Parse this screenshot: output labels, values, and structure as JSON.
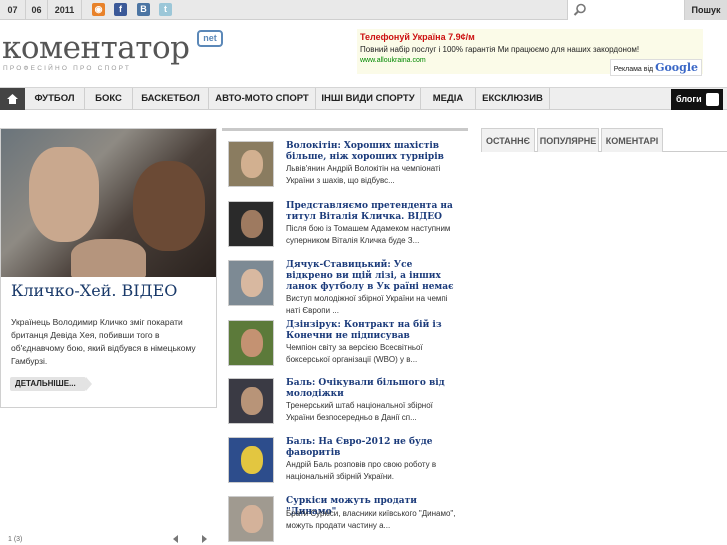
{
  "date": {
    "day": "07",
    "month": "06",
    "year": "2011"
  },
  "social_icons": [
    "rss-icon",
    "facebook-icon",
    "vkontakte-icon",
    "twitter-icon"
  ],
  "search": {
    "placeholder": "",
    "button_label": "Пошук"
  },
  "logo": {
    "word": "коментатор",
    "badge": "net",
    "tagline": "ПРОФЕСІЙНО ПРО СПОРТ"
  },
  "ad": {
    "title": "Телефонуй Україна 7.9¢/м",
    "text": "Повний набір послуг і 100% гарантія Ми працюємо для наших закордоном!",
    "url": "www.alloukraina.com",
    "provider_prefix": "Реклама від",
    "provider": "Google"
  },
  "nav": {
    "items": [
      "ФУТБОЛ",
      "БОКС",
      "БАСКЕТБОЛ",
      "АВТО-МОТО СПОРТ",
      "ІНШІ ВИДИ СПОРТУ",
      "МЕДІА",
      "ЕКСКЛЮЗИВ"
    ],
    "blog_label": "блоги"
  },
  "featured": {
    "title": "Кличко-Хей. ВІДЕО",
    "text": "Українець Володимир Кличко зміг покарати британця Девіда Хея, побивши того в об'єднавчому бою, який відбувся в німецькому Гамбурзі.",
    "more_label": "ДЕТАЛЬНІШЕ..."
  },
  "news": [
    {
      "title": "Волокітін: Хороших шахістів більше, ніж хороших турнірів",
      "text": "Львів'янин Андрій Волокітін на чемпіонаті України з шахів, що відбувс..."
    },
    {
      "title": "Представляємо претендента на титул Віталія Кличка. ВІДЕО",
      "text": "Після бою із Томашем Адамеком наступним суперником Віталія Кличка буде З..."
    },
    {
      "title": "Дячук-Ставицький: Усе відкрено ви щій лізі, а інших ланок футболу в Ук раїні немає",
      "text": "Виступ молодіжної збірної України на чемпі наті Європи ..."
    },
    {
      "title": "Дзінзірук: Контракт на бій із Конечни не підписував",
      "text": "Чемпіон світу за версією Всесвітньої боксерської організації (WBO) у в..."
    },
    {
      "title": "Баль: Очікували більшого від молодіжки",
      "text": "Тренерський штаб національної збірної України безпосередньо в Данії сп..."
    },
    {
      "title": "Баль: На Євро-2012 не буде фаворитів",
      "text": "Андрій Баль розповів про свою роботу в національній збірній України."
    },
    {
      "title": "Суркіси можуть продати \"Динамо\"",
      "text": "Брати Суркіси, власники київського \"Динамо\", можуть продати частину а..."
    }
  ],
  "pager": {
    "label": "1 (3)"
  },
  "tabs": [
    "ОСТАННЄ",
    "ПОПУЛЯРНЕ",
    "КОМЕНТАРІ"
  ]
}
